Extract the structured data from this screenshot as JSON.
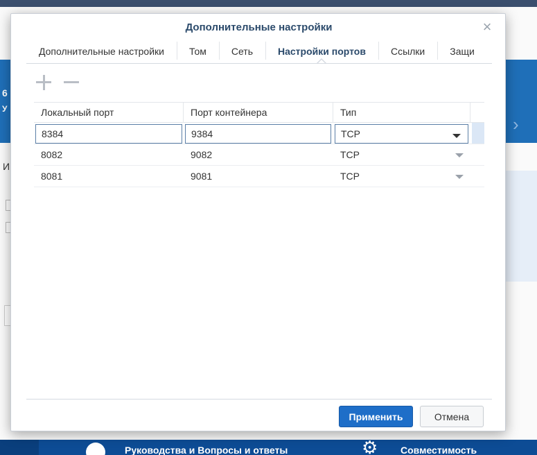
{
  "background": {
    "footer_items": [
      {
        "label": "Руководства и Вопросы и ответы"
      },
      {
        "label": "Совместимость"
      }
    ],
    "fragments": [
      "6",
      "У",
      "И"
    ]
  },
  "dialog": {
    "title": "Дополнительные настройки",
    "close_icon": "close-icon",
    "tabs": [
      {
        "label": "Дополнительные настройки"
      },
      {
        "label": "Том"
      },
      {
        "label": "Сеть"
      },
      {
        "label": "Настройки портов",
        "active": true
      },
      {
        "label": "Ссылки"
      },
      {
        "label": "Защи"
      }
    ],
    "toolbar": {
      "add_icon": "plus-icon",
      "remove_icon": "minus-icon"
    },
    "table": {
      "headers": [
        "Локальный порт",
        "Порт контейнера",
        "Тип"
      ],
      "rows": [
        {
          "local": "8384",
          "container": "9384",
          "type": "TCP",
          "editing": true
        },
        {
          "local": "8082",
          "container": "9082",
          "type": "TCP"
        },
        {
          "local": "8081",
          "container": "9081",
          "type": "TCP"
        }
      ]
    },
    "buttons": {
      "apply": "Применить",
      "cancel": "Отмена"
    }
  },
  "colors": {
    "accent": "#1e6ec8",
    "title": "#2b4a6b",
    "background_band": "#1f6fb8"
  }
}
